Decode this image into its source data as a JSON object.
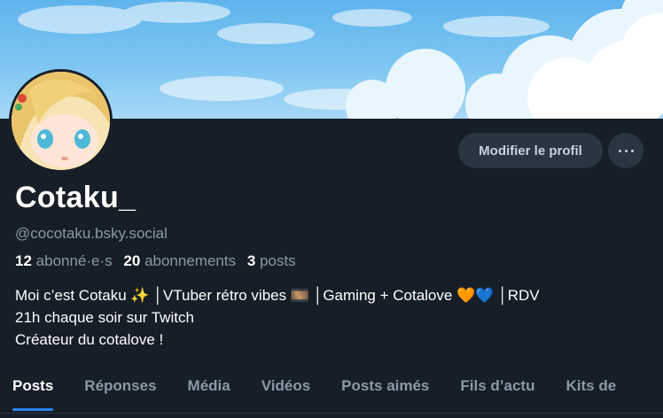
{
  "profile": {
    "display_name": "Cotaku_",
    "handle": "@cocotaku.bsky.social",
    "followers_count": "12",
    "followers_label": "abonné·e·s",
    "following_count": "20",
    "following_label": "abonnements",
    "posts_count": "3",
    "posts_label": "posts",
    "bio_lines": [
      "Moi c’est Cotaku ✨ │VTuber rétro vibes 🎞️ │Gaming + Cotalove 🧡💙 │RDV",
      "21h chaque soir sur Twitch",
      "Créateur du cotalove !"
    ]
  },
  "actions": {
    "edit_profile_label": "Modifier le profil",
    "more_options_icon": "more-horizontal-icon"
  },
  "tabs": [
    {
      "label": "Posts",
      "active": true
    },
    {
      "label": "Réponses"
    },
    {
      "label": "Média"
    },
    {
      "label": "Vidéos"
    },
    {
      "label": "Posts aimés"
    },
    {
      "label": "Fils d’actu"
    },
    {
      "label": "Kits de"
    }
  ],
  "colors": {
    "background": "#161e27",
    "button_bg": "#2a3542",
    "accent_blue": "#2a86f0",
    "muted_text": "#8b98a6",
    "banner_sky": "#7ec6f2"
  }
}
